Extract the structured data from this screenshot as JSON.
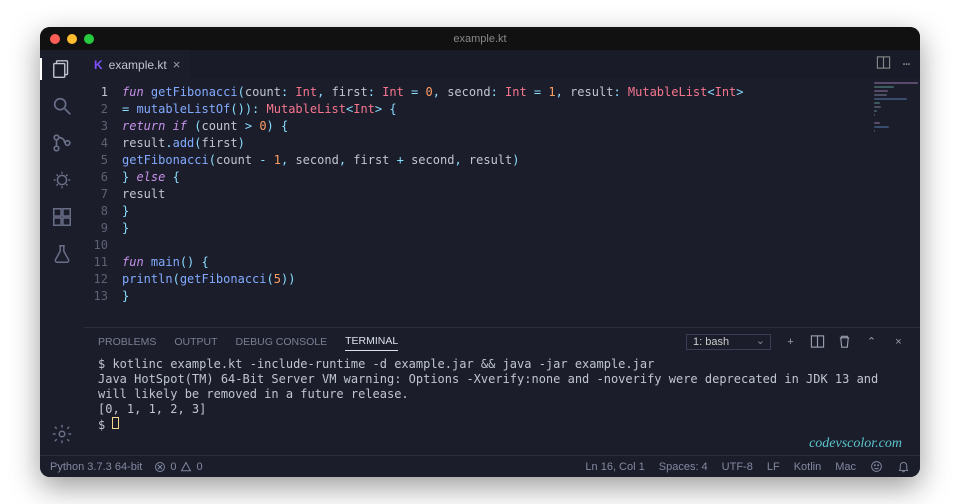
{
  "title": "example.kt",
  "tab": {
    "filename": "example.kt",
    "icon_letter": "K"
  },
  "code_lines": [
    {
      "n": 1,
      "tokens": [
        [
          "kw",
          "fun "
        ],
        [
          "fn",
          "getFibonacci"
        ],
        [
          "punct",
          "("
        ],
        [
          "param",
          "count"
        ],
        [
          "punct",
          ": "
        ],
        [
          "type",
          "Int"
        ],
        [
          "punct",
          ", "
        ],
        [
          "param",
          "first"
        ],
        [
          "punct",
          ": "
        ],
        [
          "type",
          "Int"
        ],
        [
          "punct",
          " = "
        ],
        [
          "num",
          "0"
        ],
        [
          "punct",
          ", "
        ],
        [
          "param",
          "second"
        ],
        [
          "punct",
          ": "
        ],
        [
          "type",
          "Int"
        ],
        [
          "punct",
          " = "
        ],
        [
          "num",
          "1"
        ],
        [
          "punct",
          ", "
        ],
        [
          "param",
          "result"
        ],
        [
          "punct",
          ": "
        ],
        [
          "type",
          "MutableList"
        ],
        [
          "punct",
          "<"
        ],
        [
          "type",
          "Int"
        ],
        [
          "punct",
          ">"
        ]
      ]
    },
    {
      "n": 2,
      "tokens": [
        [
          "punct",
          "= "
        ],
        [
          "fn",
          "mutableListOf"
        ],
        [
          "punct",
          "()"
        ],
        [
          "punct",
          "): "
        ],
        [
          "type",
          "MutableList"
        ],
        [
          "punct",
          "<"
        ],
        [
          "type",
          "Int"
        ],
        [
          "punct",
          "> {"
        ]
      ]
    },
    {
      "n": 3,
      "tokens": [
        [
          "plain",
          "    "
        ],
        [
          "kw",
          "return if "
        ],
        [
          "punct",
          "("
        ],
        [
          "plain",
          "count "
        ],
        [
          "punct",
          ">"
        ],
        [
          "plain",
          " "
        ],
        [
          "num",
          "0"
        ],
        [
          "punct",
          ") {"
        ]
      ]
    },
    {
      "n": 4,
      "tokens": [
        [
          "plain",
          "        result"
        ],
        [
          "punct",
          "."
        ],
        [
          "fn",
          "add"
        ],
        [
          "punct",
          "("
        ],
        [
          "plain",
          "first"
        ],
        [
          "punct",
          ")"
        ]
      ]
    },
    {
      "n": 5,
      "tokens": [
        [
          "plain",
          "        "
        ],
        [
          "fn",
          "getFibonacci"
        ],
        [
          "punct",
          "("
        ],
        [
          "plain",
          "count "
        ],
        [
          "punct",
          "-"
        ],
        [
          "plain",
          " "
        ],
        [
          "num",
          "1"
        ],
        [
          "punct",
          ", "
        ],
        [
          "plain",
          "second"
        ],
        [
          "punct",
          ", "
        ],
        [
          "plain",
          "first "
        ],
        [
          "punct",
          "+"
        ],
        [
          "plain",
          " second"
        ],
        [
          "punct",
          ", "
        ],
        [
          "plain",
          "result"
        ],
        [
          "punct",
          ")"
        ]
      ]
    },
    {
      "n": 6,
      "tokens": [
        [
          "plain",
          "    "
        ],
        [
          "punct",
          "}"
        ],
        [
          "kw",
          " else "
        ],
        [
          "punct",
          "{"
        ]
      ]
    },
    {
      "n": 7,
      "tokens": [
        [
          "plain",
          "        result"
        ]
      ]
    },
    {
      "n": 8,
      "tokens": [
        [
          "plain",
          "    "
        ],
        [
          "punct",
          "}"
        ]
      ]
    },
    {
      "n": 9,
      "tokens": [
        [
          "punct",
          "}"
        ]
      ]
    },
    {
      "n": 10,
      "tokens": []
    },
    {
      "n": 11,
      "tokens": [
        [
          "kw",
          "fun "
        ],
        [
          "fn",
          "main"
        ],
        [
          "punct",
          "() {"
        ]
      ]
    },
    {
      "n": 12,
      "tokens": [
        [
          "plain",
          "    "
        ],
        [
          "fn",
          "println"
        ],
        [
          "punct",
          "("
        ],
        [
          "fn",
          "getFibonacci"
        ],
        [
          "punct",
          "("
        ],
        [
          "num",
          "5"
        ],
        [
          "punct",
          "))"
        ]
      ]
    },
    {
      "n": 13,
      "tokens": [
        [
          "punct",
          "}"
        ]
      ]
    }
  ],
  "panel": {
    "tabs": {
      "problems": "PROBLEMS",
      "output": "OUTPUT",
      "debug": "DEBUG CONSOLE",
      "terminal": "TERMINAL"
    },
    "shell_select": "1: bash",
    "lines": [
      "$ kotlinc example.kt -include-runtime -d example.jar && java -jar example.jar",
      "Java HotSpot(TM) 64-Bit Server VM warning: Options -Xverify:none and -noverify were deprecated in JDK 13 and will likely be removed in a future release.",
      "[0, 1, 1, 2, 3]",
      "$ "
    ]
  },
  "watermark": "codevscolor.com",
  "status": {
    "left1": "Python 3.7.3 64-bit",
    "errs": "0",
    "warns": "0",
    "ln_col": "Ln 16, Col 1",
    "spaces": "Spaces: 4",
    "encoding": "UTF-8",
    "eol": "LF",
    "lang": "Kotlin",
    "os": "Mac"
  },
  "active_line": 1
}
